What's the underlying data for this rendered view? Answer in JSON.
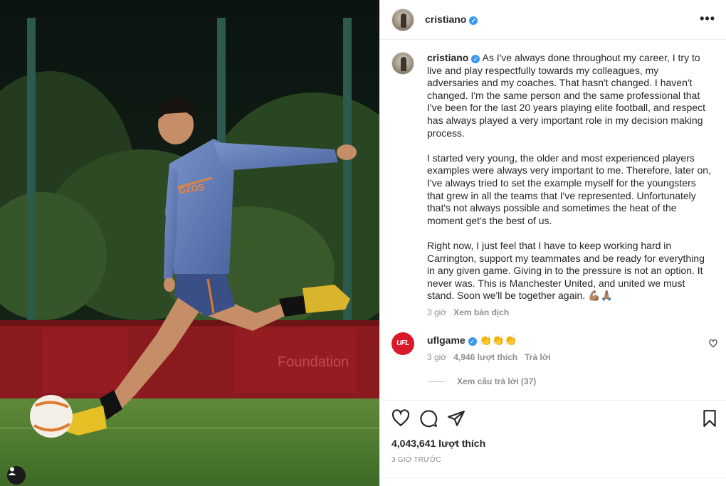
{
  "post": {
    "author": "cristiano",
    "caption_author": "cristiano",
    "caption_p1": "As I've always done throughout my career, I try to live and play respectfully towards my colleagues, my adversaries and my coaches. That hasn't changed. I haven't changed. I'm the same person and the same professional that I've been for the last 20 years playing elite football, and respect has always played a very important role in my decision making process.",
    "caption_p2": "I started very young, the older and most experienced players examples were always very important to me. Therefore, later on, I've always tried to set the example myself for the youngsters that grew in all the teams that I've represented. Unfortunately that's not always possible and sometimes the heat of the moment get's the best of us.",
    "caption_p3": "Right now, I just feel that I have to keep working hard in Carrington, support my teammates and be ready for everything in any given game. Giving in to the pressure is not an option. It never was. This is Manchester United, and united we must stand. Soon we'll be together again. 💪🏽🙏🏽",
    "caption_time": "3 giờ",
    "translate_label": "Xem bản dịch",
    "likes_label": "4,043,641 lượt thích",
    "timestamp": "3 GIỜ TRƯỚC"
  },
  "comment": {
    "author": "uflgame",
    "avatar_text": "UFL",
    "text": "👏👏👏",
    "time": "3 giờ",
    "likes": "4,946 lượt thích",
    "reply_label": "Trả lời",
    "view_replies": "Xem câu trả lời (37)"
  },
  "photo_banner": {
    "sponsor": "DZOS",
    "board_text": "Foundation"
  },
  "colors": {
    "verified": "#3897f0",
    "ufl_red": "#d7192a",
    "secondary_text": "#8e8e8e"
  },
  "icons": [
    "more-options-icon",
    "verified-icon",
    "heart-icon",
    "comment-icon",
    "share-icon",
    "bookmark-icon",
    "small-heart-icon",
    "user-tag-icon"
  ]
}
